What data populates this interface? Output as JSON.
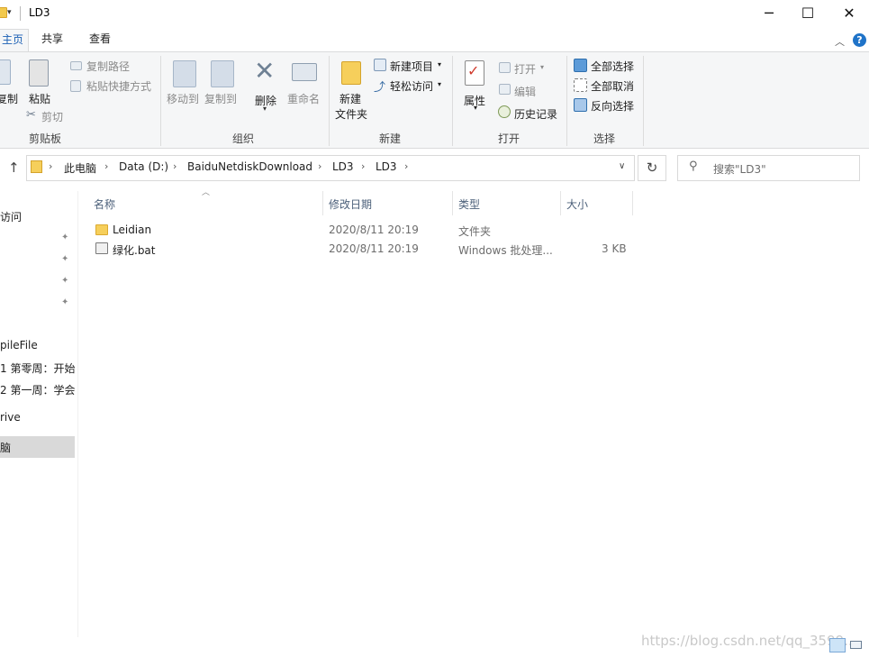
{
  "window": {
    "title": "LD3",
    "minimize": "─",
    "maximize": "☐",
    "close": "✕"
  },
  "tabs": [
    "主页",
    "共享",
    "查看"
  ],
  "tab_active_visible": "主页",
  "ribbon": {
    "clipboard": {
      "label": "剪贴板",
      "copy_partial": "复制",
      "paste": "粘贴",
      "copy_path": "复制路径",
      "paste_shortcut": "粘贴快捷方式",
      "cut": "剪切"
    },
    "organize": {
      "label": "组织",
      "move_to": "移动到",
      "copy_to": "复制到",
      "delete": "删除",
      "rename": "重命名"
    },
    "new": {
      "label": "新建",
      "new_folder_line1": "新建",
      "new_folder_line2": "文件夹",
      "new_item": "新建项目",
      "easy_access": "轻松访问"
    },
    "open": {
      "label": "打开",
      "properties": "属性",
      "open": "打开",
      "edit": "编辑",
      "history": "历史记录"
    },
    "select": {
      "label": "选择",
      "select_all": "全部选择",
      "select_none": "全部取消",
      "invert": "反向选择"
    }
  },
  "address": {
    "breadcrumbs": [
      "此电脑",
      "Data (D:)",
      "BaiduNetdiskDownload",
      "LD3",
      "LD3"
    ],
    "search_placeholder": "搜索\"LD3\""
  },
  "nav": {
    "items": [
      "访问",
      "pileFile",
      "1 第零周：开始",
      "2 第一周：学会",
      "rive",
      "脑"
    ]
  },
  "columns": {
    "name": "名称",
    "modified": "修改日期",
    "type": "类型",
    "size": "大小"
  },
  "files": [
    {
      "name": "Leidian",
      "modified": "2020/8/11 20:19",
      "type": "文件夹",
      "size": ""
    },
    {
      "name": "绿化.bat",
      "modified": "2020/8/11 20:19",
      "type": "Windows 批处理...",
      "size": "3 KB"
    }
  ],
  "watermark": "https://blog.csdn.net/qq_3599...",
  "icons": {
    "help": "help-icon",
    "up": "up-arrow-icon",
    "collapse": "chevron-up-icon"
  },
  "colors": {
    "accent": "#1a5fb4",
    "ribbon_bg": "#f5f6f7",
    "selected_nav": "#d9d9d9"
  }
}
